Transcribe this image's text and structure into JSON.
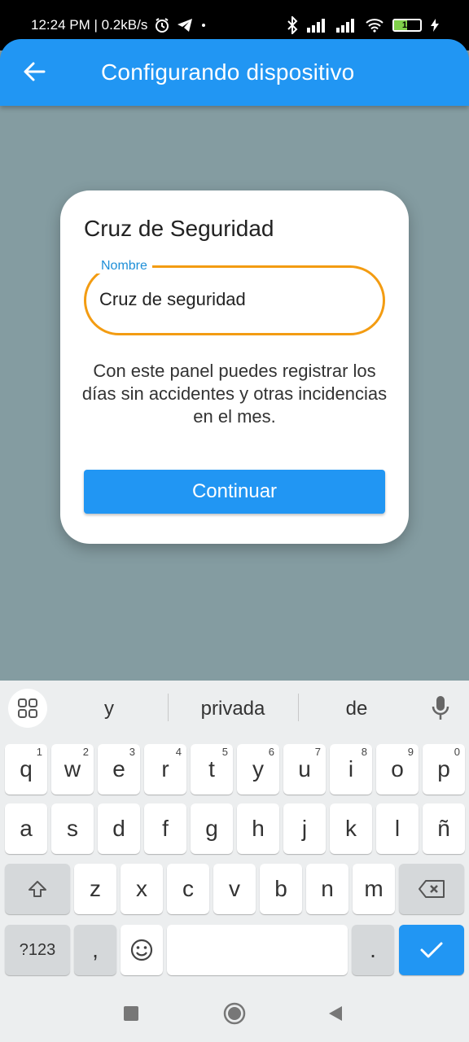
{
  "status_bar": {
    "time_speed": "12:24 PM | 0.2kB/s",
    "battery_level": "17",
    "icons": [
      "alarm-icon",
      "telegram-icon",
      "dot-icon",
      "bluetooth-icon",
      "signal-icon",
      "signal-icon",
      "wifi-icon",
      "battery-icon",
      "charging-icon"
    ]
  },
  "app_bar": {
    "title": "Configurando dispositivo",
    "back_icon": "arrow-left-icon",
    "color": "#2196f3"
  },
  "card": {
    "title": "Cruz de Seguridad",
    "field_label": "Nombre",
    "field_value": "Cruz de seguridad",
    "description": "Con este panel puedes registrar los días sin accidentes y otras incidencias en el mes.",
    "button_label": "Continuar",
    "field_border_color": "#f39c12"
  },
  "keyboard": {
    "suggestions": [
      "y",
      "privada",
      "de"
    ],
    "row1": [
      {
        "k": "q",
        "h": "1"
      },
      {
        "k": "w",
        "h": "2"
      },
      {
        "k": "e",
        "h": "3"
      },
      {
        "k": "r",
        "h": "4"
      },
      {
        "k": "t",
        "h": "5"
      },
      {
        "k": "y",
        "h": "6"
      },
      {
        "k": "u",
        "h": "7"
      },
      {
        "k": "i",
        "h": "8"
      },
      {
        "k": "o",
        "h": "9"
      },
      {
        "k": "p",
        "h": "0"
      }
    ],
    "row2": [
      "a",
      "s",
      "d",
      "f",
      "g",
      "h",
      "j",
      "k",
      "l",
      "ñ"
    ],
    "row3": [
      "z",
      "x",
      "c",
      "v",
      "b",
      "n",
      "m"
    ],
    "num_key": "?123",
    "comma_key": ",",
    "period_key": "."
  }
}
